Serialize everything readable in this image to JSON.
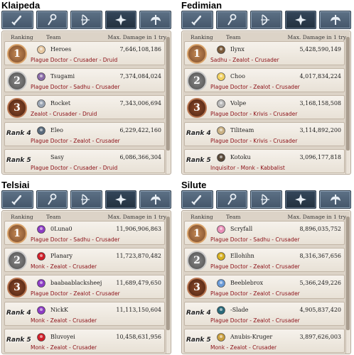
{
  "tab_icons": [
    "sword-icon",
    "staff-icon",
    "bow-icon",
    "cross-icon",
    "wings-icon"
  ],
  "active_tab": 3,
  "header": {
    "ranking": "Ranking",
    "team": "Team",
    "damage": "Max. Damage in 1 try"
  },
  "colors": {
    "class_text": "#8b0f16",
    "tab_bg": "#4f6277",
    "board_bg": "#dcd3c7"
  },
  "servers": [
    {
      "name": "Klaipeda",
      "rows": [
        {
          "rank": "1",
          "rank_style": "gold",
          "icon": "sunglasses-icon",
          "team": "Heroes",
          "damage": "7,646,108,186",
          "classes": "Plague Doctor - Crusader - Druid"
        },
        {
          "rank": "2",
          "rank_style": "silver",
          "icon": "purple-emblem-icon",
          "team": "Tsugami",
          "damage": "7,374,084,024",
          "classes": "Plague Doctor - Sadhu - Crusader"
        },
        {
          "rank": "3",
          "rank_style": "bronze",
          "icon": "round-emblem-icon",
          "team": "Rocket",
          "damage": "7,343,006,694",
          "classes": "Zealot - Crusader - Druid"
        },
        {
          "rank": "Rank 4",
          "rank_style": "text",
          "icon": "trophy-icon",
          "team": "Eleo",
          "damage": "6,229,422,160",
          "classes": "Plague Doctor - Zealot - Crusader"
        },
        {
          "rank": "Rank 5",
          "rank_style": "text",
          "icon": "",
          "team": "Sasy",
          "damage": "6,086,366,304",
          "classes": "Plague Doctor - Crusader - Druid"
        }
      ]
    },
    {
      "name": "Fedimian",
      "rows": [
        {
          "rank": "1",
          "rank_style": "gold",
          "icon": "shield-person-icon",
          "team": "Ilynx",
          "damage": "5,428,590,149",
          "classes": "Sadhu - Zealot - Crusader"
        },
        {
          "rank": "2",
          "rank_style": "silver",
          "icon": "yellow-chick-icon",
          "team": "Choo",
          "damage": "4,017,834,224",
          "classes": "Plague Doctor - Zealot - Crusader"
        },
        {
          "rank": "3",
          "rank_style": "bronze",
          "icon": "grey-square-icon",
          "team": "Volpe",
          "damage": "3,168,158,508",
          "classes": "Plague Doctor - Krivis - Crusader"
        },
        {
          "rank": "Rank 4",
          "rank_style": "text",
          "icon": "tan-emblem-icon",
          "team": "Tiliteam",
          "damage": "3,114,892,200",
          "classes": "Plague Doctor - Krivis - Crusader"
        },
        {
          "rank": "Rank 5",
          "rank_style": "text",
          "icon": "dark-emblem-icon",
          "team": "Kotoku",
          "damage": "3,096,177,818",
          "classes": "Inquisitor - Monk - Kabbalist"
        }
      ]
    },
    {
      "name": "Telsiai",
      "rows": [
        {
          "rank": "1",
          "rank_style": "gold",
          "icon": "purple-runner-icon",
          "team": "0Luna0",
          "damage": "11,906,906,863",
          "classes": "Plague Doctor - Sadhu - Crusader"
        },
        {
          "rank": "2",
          "rank_style": "silver",
          "icon": "red-runner-icon",
          "team": "Planary",
          "damage": "11,723,870,482",
          "classes": "Monk - Zealot - Crusader"
        },
        {
          "rank": "3",
          "rank_style": "bronze",
          "icon": "purple-runner-icon",
          "team": "baabaablacksheej",
          "damage": "11,689,479,650",
          "classes": "Plague Doctor - Zealot - Crusader"
        },
        {
          "rank": "Rank 4",
          "rank_style": "text",
          "icon": "purple-runner-icon",
          "team": "NickK",
          "damage": "11,113,150,604",
          "classes": "Monk - Zealot - Crusader"
        },
        {
          "rank": "Rank 5",
          "rank_style": "text",
          "icon": "red-runner-icon",
          "team": "Bluvoyei",
          "damage": "10,458,631,956",
          "classes": "Monk - Zealot - Crusader"
        }
      ]
    },
    {
      "name": "Silute",
      "rows": [
        {
          "rank": "1",
          "rank_style": "gold",
          "icon": "pink-face-icon",
          "team": "Scryfall",
          "damage": "8,896,035,752",
          "classes": "Plague Doctor - Sadhu - Crusader"
        },
        {
          "rank": "2",
          "rank_style": "silver",
          "icon": "yellow-emblem-icon",
          "team": "Ellohihn",
          "damage": "8,316,367,656",
          "classes": "Plague Doctor - Zealot - Crusader"
        },
        {
          "rank": "3",
          "rank_style": "bronze",
          "icon": "blue-emblem-icon",
          "team": "Beeblebrox",
          "damage": "5,366,249,226",
          "classes": "Plague Doctor - Zealot - Crusader"
        },
        {
          "rank": "Rank 4",
          "rank_style": "text",
          "icon": "teal-emblem-icon",
          "team": "-Slade",
          "damage": "4,905,837,420",
          "classes": "Plague Doctor - Zealot - Crusader"
        },
        {
          "rank": "Rank 5",
          "rank_style": "text",
          "icon": "gold-emblem-icon",
          "team": "Anubis-Kruger",
          "damage": "3,897,626,003",
          "classes": "Monk - Zealot - Crusader"
        }
      ]
    }
  ]
}
